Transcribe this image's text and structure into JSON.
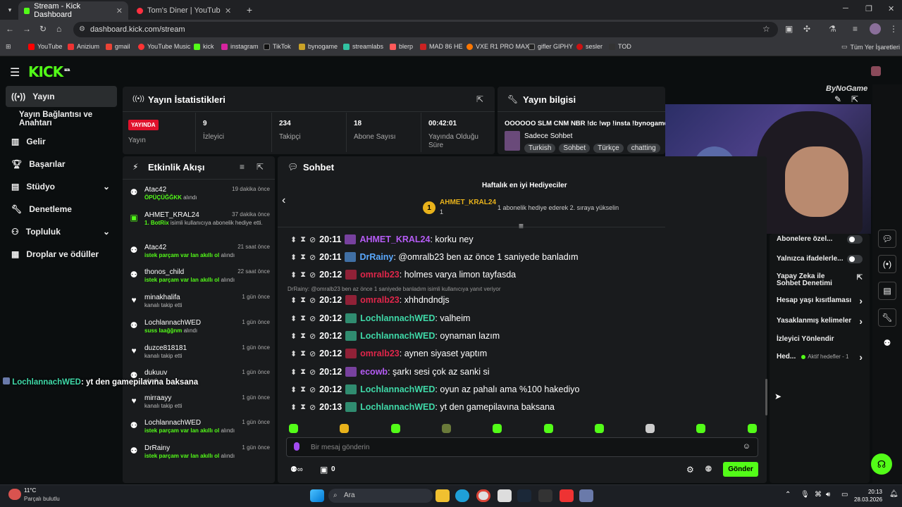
{
  "browser": {
    "tabs": [
      {
        "title": "Stream - Kick Dashboard"
      },
      {
        "title": "Tom's Diner | YouTube Music"
      }
    ],
    "url": "dashboard.kick.com/stream",
    "bookmarks": [
      "YouTube",
      "Anizium",
      "gmail",
      "YouTube Music",
      "kick",
      "instagram",
      "TikTok",
      "bynogame",
      "streamlabs",
      "blerp",
      "MAD 86 HE",
      "VXE R1 PRO MAX",
      "gifler GIPHY",
      "sesler",
      "TOD"
    ],
    "all_bookmarks": "Tüm Yer İşaretleri"
  },
  "logo": "KICK",
  "logo_beta": "BETA",
  "nav": [
    "Yayın",
    "Yayın Bağlantısı ve Anahtarı",
    "Gelir",
    "Başarılar",
    "Stüdyo",
    "Denetleme",
    "Topluluk",
    "Droplar ve ödüller"
  ],
  "stats": {
    "title": "Yayın İstatistikleri",
    "live": "YAYINDA",
    "live_label": "Yayın",
    "cells": [
      {
        "num": "9",
        "label": "İzleyici"
      },
      {
        "num": "234",
        "label": "Takipçi"
      },
      {
        "num": "18",
        "label": "Abone Sayısı"
      },
      {
        "num": "00:42:01",
        "label": "Yayında Olduğu Süre"
      }
    ]
  },
  "info": {
    "title": "Yayın bilgisi",
    "stream_title": "OOOOOO SLM CNM NBR !dc !wp !insta !bynogame",
    "category": "Sadece Sohbet",
    "tags": [
      "Turkish",
      "Sohbet",
      "Türkçe",
      "chatting"
    ]
  },
  "activity": {
    "title": "Etkinlik Akışı",
    "items": [
      {
        "name": "Atac42",
        "time": "19 dakika önce",
        "sub_green": "ÖPÜÇÜĞĞKK",
        "sub": " alındı",
        "icon": "points-icon"
      },
      {
        "name": "AHMET_KRAL24",
        "time": "37 dakika önce",
        "sub_green": "1. BotRix",
        "sub": " isimli kullanıcıya abonelik hediye etti.",
        "icon": "gift-icon"
      },
      {
        "name": "Atac42",
        "time": "21 saat önce",
        "sub_green": "istek parçam var lan akıllı ol",
        "sub": " alındı",
        "icon": "points-icon"
      },
      {
        "name": "thonos_child",
        "time": "22 saat önce",
        "sub_green": "istek parçam var lan akıllı ol",
        "sub": " alındı",
        "icon": "points-icon"
      },
      {
        "name": "minakhalifa",
        "time": "1 gün önce",
        "sub_green": "",
        "sub": "kanalı takip etti",
        "icon": "heart-icon"
      },
      {
        "name": "LochlannachWED",
        "time": "1 gün önce",
        "sub_green": "suss laağğnm",
        "sub": " alındı",
        "icon": "points-icon"
      },
      {
        "name": "duzce818181",
        "time": "1 gün önce",
        "sub_green": "",
        "sub": "kanalı takip etti",
        "icon": "heart-icon"
      },
      {
        "name": "dukuuv",
        "time": "1 gün önce",
        "sub_green": "",
        "sub": "alındı",
        "icon": "points-icon"
      },
      {
        "name": "mirraayy",
        "time": "1 gün önce",
        "sub_green": "",
        "sub": "kanalı takip etti",
        "icon": "heart-icon"
      },
      {
        "name": "LochlannachWED",
        "time": "1 gün önce",
        "sub_green": "istek parçam var lan akıllı ol",
        "sub": " alındı",
        "icon": "points-icon"
      },
      {
        "name": "DrRainy",
        "time": "1 gün önce",
        "sub_green": "istek parçam var lan akıllı ol",
        "sub": " alındı",
        "icon": "points-icon"
      }
    ]
  },
  "overlay_msg": {
    "user": "LochlannachWED",
    "text": ": yt den gamepilavına baksana"
  },
  "chat": {
    "title": "Sohbet",
    "gifters_title": "Haftalık en iyi Hediyeciler",
    "top_gifter": "AHMET_KRAL24",
    "top_gifter_count": "1",
    "gift_note": "1 abonelik hediye ederek 2. sıraya yükselin",
    "reply_note": "DrRainy: @omralb23 ben az önce 1 saniyede banladım isimli kullanıcıya yanıt veriyor",
    "messages": [
      {
        "time": "20:11",
        "user": "AHMET_KRAL24",
        "color": "#b55cf5",
        "text": ": korku ney"
      },
      {
        "time": "20:11",
        "user": "DrRainy",
        "color": "#5aa9ff",
        "text": ": @omralb23 ben az önce 1 saniyede banladım"
      },
      {
        "time": "20:12",
        "user": "omralb23",
        "color": "#e0264a",
        "text": ": holmes varya limon tayfasda"
      },
      {
        "time": "20:12",
        "user": "omralb23",
        "color": "#e0264a",
        "text": ": xhhdndndjs"
      },
      {
        "time": "20:12",
        "user": "LochlannachWED",
        "color": "#3fd9a8",
        "text": ": valheim"
      },
      {
        "time": "20:12",
        "user": "LochlannachWED",
        "color": "#3fd9a8",
        "text": ": oynaman lazım"
      },
      {
        "time": "20:12",
        "user": "omralb23",
        "color": "#e0264a",
        "text": ": aynen siyaset yaptım"
      },
      {
        "time": "20:12",
        "user": "ecowb",
        "color": "#b55cf5",
        "text": ": şarkı sesi çok az sanki si"
      },
      {
        "time": "20:12",
        "user": "LochlannachWED",
        "color": "#3fd9a8",
        "text": ": oyun az pahalı ama %100 hakediyo"
      },
      {
        "time": "20:13",
        "user": "LochlannachWED",
        "color": "#3fd9a8",
        "text": ": yt den gamepilavına baksana"
      }
    ],
    "placeholder": "Bir mesaj gönderin",
    "points": "0",
    "send": "Gönder"
  },
  "settings": {
    "rows": [
      "Abonelere özel...",
      "Yalnızca ifadelerle...",
      "Yapay Zeka ile Sohbet Denetimi",
      "Hesap yaşı kısıtlaması",
      "Yasaklanmış kelimeler",
      "İzleyici Yönlendir",
      "Hed..."
    ],
    "active_goals": "Aktif hedefler - 1"
  },
  "webcam_badge": "ByNoGame",
  "taskbar": {
    "weather_temp": "11°C",
    "weather_desc": "Parçalı bulutlu",
    "search": "Ara",
    "time": "20:13",
    "date": "28.03.2026"
  },
  "colors": {
    "kick_green": "#53fc18",
    "live_red": "#e0112b"
  }
}
